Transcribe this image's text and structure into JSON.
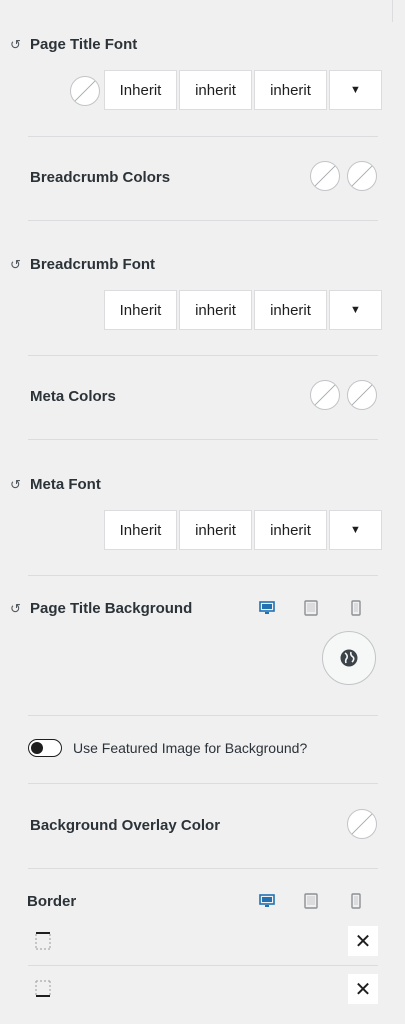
{
  "page_title_font": {
    "label": "Page Title Font",
    "reset_icon": "↺",
    "values": [
      "Inherit",
      "inherit",
      "inherit"
    ],
    "caret": "▼"
  },
  "breadcrumb_colors": {
    "label": "Breadcrumb Colors"
  },
  "breadcrumb_font": {
    "label": "Breadcrumb Font",
    "reset_icon": "↺",
    "values": [
      "Inherit",
      "inherit",
      "inherit"
    ],
    "caret": "▼"
  },
  "meta_colors": {
    "label": "Meta Colors"
  },
  "meta_font": {
    "label": "Meta Font",
    "reset_icon": "↺",
    "values": [
      "Inherit",
      "inherit",
      "inherit"
    ],
    "caret": "▼"
  },
  "page_title_background": {
    "label": "Page Title Background",
    "reset_icon": "↺",
    "active_device": "desktop",
    "accent_color": "#2271b1"
  },
  "featured_image": {
    "label": "Use Featured Image for Background?",
    "enabled": false
  },
  "overlay": {
    "label": "Background Overlay Color"
  },
  "border": {
    "label": "Border",
    "active_device": "desktop",
    "remove_icon": "✕"
  }
}
